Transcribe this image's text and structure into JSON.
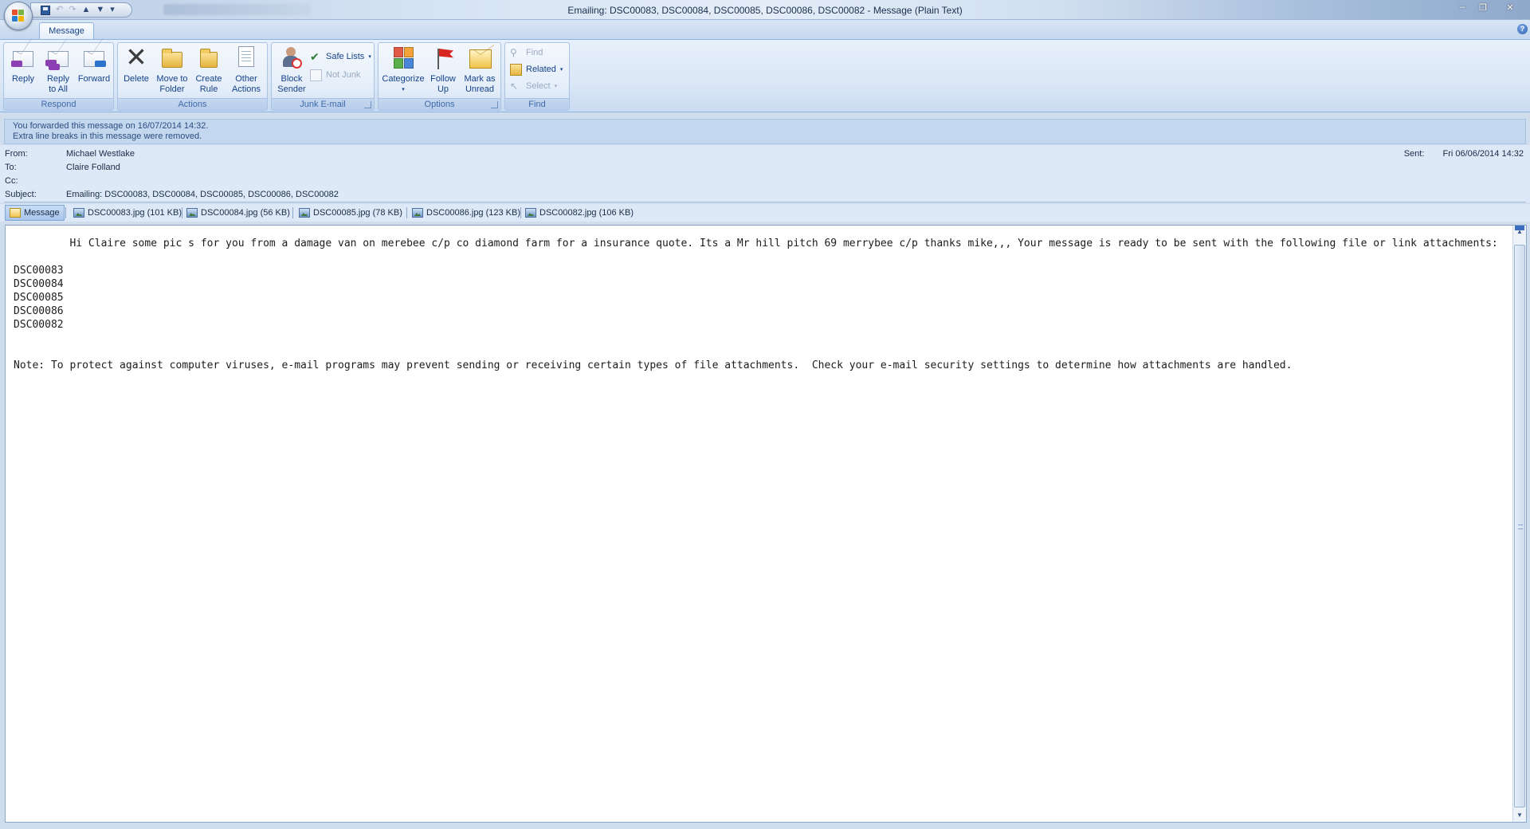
{
  "window": {
    "title": "Emailing: DSC00083, DSC00084, DSC00085, DSC00086, DSC00082 - Message (Plain Text)",
    "minimize_glyph": "–",
    "maximize_glyph": "❐",
    "close_glyph": "✕"
  },
  "qat": {
    "undo_glyph": "↶",
    "redo_glyph": "↷",
    "prev_glyph": "▲",
    "next_glyph": "▼",
    "customize_glyph": "▾"
  },
  "ribbon": {
    "tab": "Message",
    "help_glyph": "?",
    "groups": {
      "respond": {
        "label": "Respond",
        "reply": "Reply",
        "reply_all": "Reply\nto All",
        "forward": "Forward"
      },
      "actions": {
        "label": "Actions",
        "delete": "Delete",
        "move_to_folder": "Move to\nFolder",
        "create_rule": "Create\nRule",
        "other_actions": "Other\nActions"
      },
      "junk": {
        "label": "Junk E-mail",
        "block_sender": "Block\nSender",
        "safe_lists": "Safe Lists",
        "not_junk": "Not Junk"
      },
      "options": {
        "label": "Options",
        "categorize": "Categorize",
        "follow_up": "Follow\nUp",
        "mark_unread": "Mark as\nUnread"
      },
      "find": {
        "label": "Find",
        "find": "Find",
        "related": "Related",
        "select": "Select"
      }
    },
    "dropdown_glyph": "▾"
  },
  "infobar": {
    "line1": "You forwarded this message on 16/07/2014 14:32.",
    "line2": "Extra line breaks in this message were removed."
  },
  "header": {
    "from_label": "From:",
    "from": "Michael Westlake",
    "to_label": "To:",
    "to": "Claire Folland",
    "cc_label": "Cc:",
    "cc": "",
    "subject_label": "Subject:",
    "subject": "Emailing: DSC00083, DSC00084, DSC00085, DSC00086, DSC00082",
    "sent_label": "Sent:",
    "sent": "Fri 06/06/2014 14:32"
  },
  "attachments": {
    "message_tab": "Message",
    "files": [
      "DSC00083.jpg (101 KB)",
      "DSC00084.jpg (56 KB)",
      "DSC00085.jpg (78 KB)",
      "DSC00086.jpg (123 KB)",
      "DSC00082.jpg (106 KB)"
    ]
  },
  "body": {
    "text": "         Hi Claire some pic s for you from a damage van on merebee c/p co diamond farm for a insurance quote. Its a Mr hill pitch 69 merrybee c/p thanks mike,,, Your message is ready to be sent with the following file or link attachments:\n\nDSC00083\nDSC00084\nDSC00085\nDSC00086\nDSC00082\n\n\nNote: To protect against computer viruses, e-mail programs may prevent sending or receiving certain types of file attachments.  Check your e-mail security settings to determine how attachments are handled."
  },
  "scrollbar": {
    "up_glyph": "▲",
    "down_glyph": "▼"
  },
  "colors": {
    "ribbon_text": "#15428b",
    "group_label": "#3e6aaa",
    "header_bg": "#dde9f7",
    "infobar_bg": "#c3d7ee",
    "body_bg": "#ffffff"
  }
}
